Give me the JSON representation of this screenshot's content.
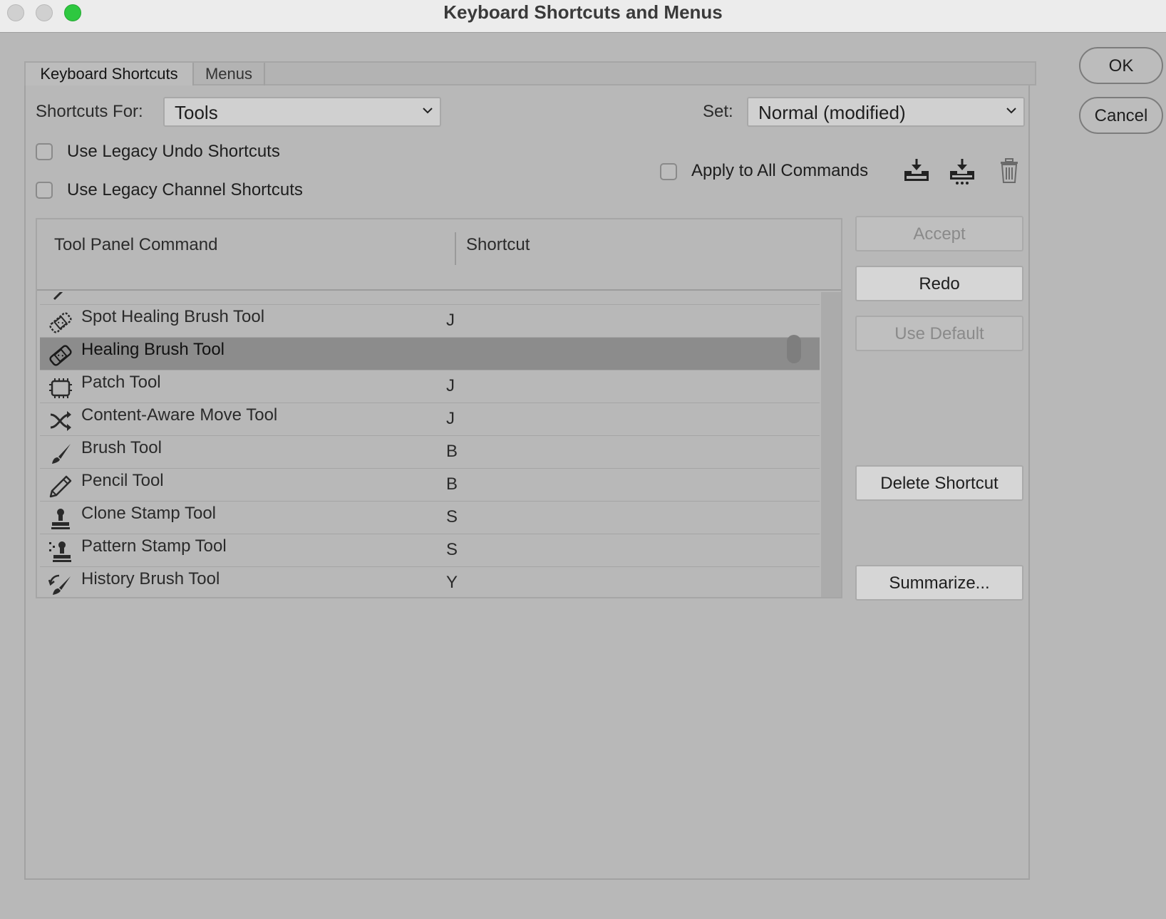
{
  "window": {
    "title": "Keyboard Shortcuts and Menus"
  },
  "tabs": [
    {
      "label": "Keyboard Shortcuts",
      "active": true
    },
    {
      "label": "Menus",
      "active": false
    }
  ],
  "shortcuts_for": {
    "label": "Shortcuts For:",
    "value": "Tools"
  },
  "set": {
    "label": "Set:",
    "value": "Normal (modified)"
  },
  "checkboxes": {
    "legacy_undo": {
      "label": "Use Legacy Undo Shortcuts",
      "checked": false
    },
    "legacy_channel": {
      "label": "Use Legacy Channel Shortcuts",
      "checked": false
    },
    "apply_all": {
      "label": "Apply to All Commands",
      "checked": false
    }
  },
  "icons": {
    "save_set": "save-set-icon",
    "save_set_as": "save-set-as-icon",
    "delete_set": "trash-icon"
  },
  "table": {
    "headers": {
      "command": "Tool Panel Command",
      "shortcut": "Shortcut"
    },
    "rows": [
      {
        "name": "Spot Healing Brush Tool",
        "shortcut": "J",
        "icon": "bandage-icon",
        "selected": false
      },
      {
        "name": "Healing Brush Tool",
        "shortcut": "",
        "icon": "bandage-icon",
        "selected": true
      },
      {
        "name": "Patch Tool",
        "shortcut": "J",
        "icon": "patch-icon",
        "selected": false
      },
      {
        "name": "Content-Aware Move Tool",
        "shortcut": "J",
        "icon": "content-aware-move-icon",
        "selected": false
      },
      {
        "name": "Brush Tool",
        "shortcut": "B",
        "icon": "brush-icon",
        "selected": false
      },
      {
        "name": "Pencil Tool",
        "shortcut": "B",
        "icon": "pencil-icon",
        "selected": false
      },
      {
        "name": "Clone Stamp Tool",
        "shortcut": "S",
        "icon": "clone-stamp-icon",
        "selected": false
      },
      {
        "name": "Pattern Stamp Tool",
        "shortcut": "S",
        "icon": "pattern-stamp-icon",
        "selected": false
      },
      {
        "name": "History Brush Tool",
        "shortcut": "Y",
        "icon": "history-brush-icon",
        "selected": false
      }
    ]
  },
  "side_buttons": {
    "accept": "Accept",
    "redo": "Redo",
    "use_default": "Use Default",
    "delete_shortcut": "Delete Shortcut",
    "summarize": "Summarize..."
  },
  "dialog_buttons": {
    "ok": "OK",
    "cancel": "Cancel"
  }
}
